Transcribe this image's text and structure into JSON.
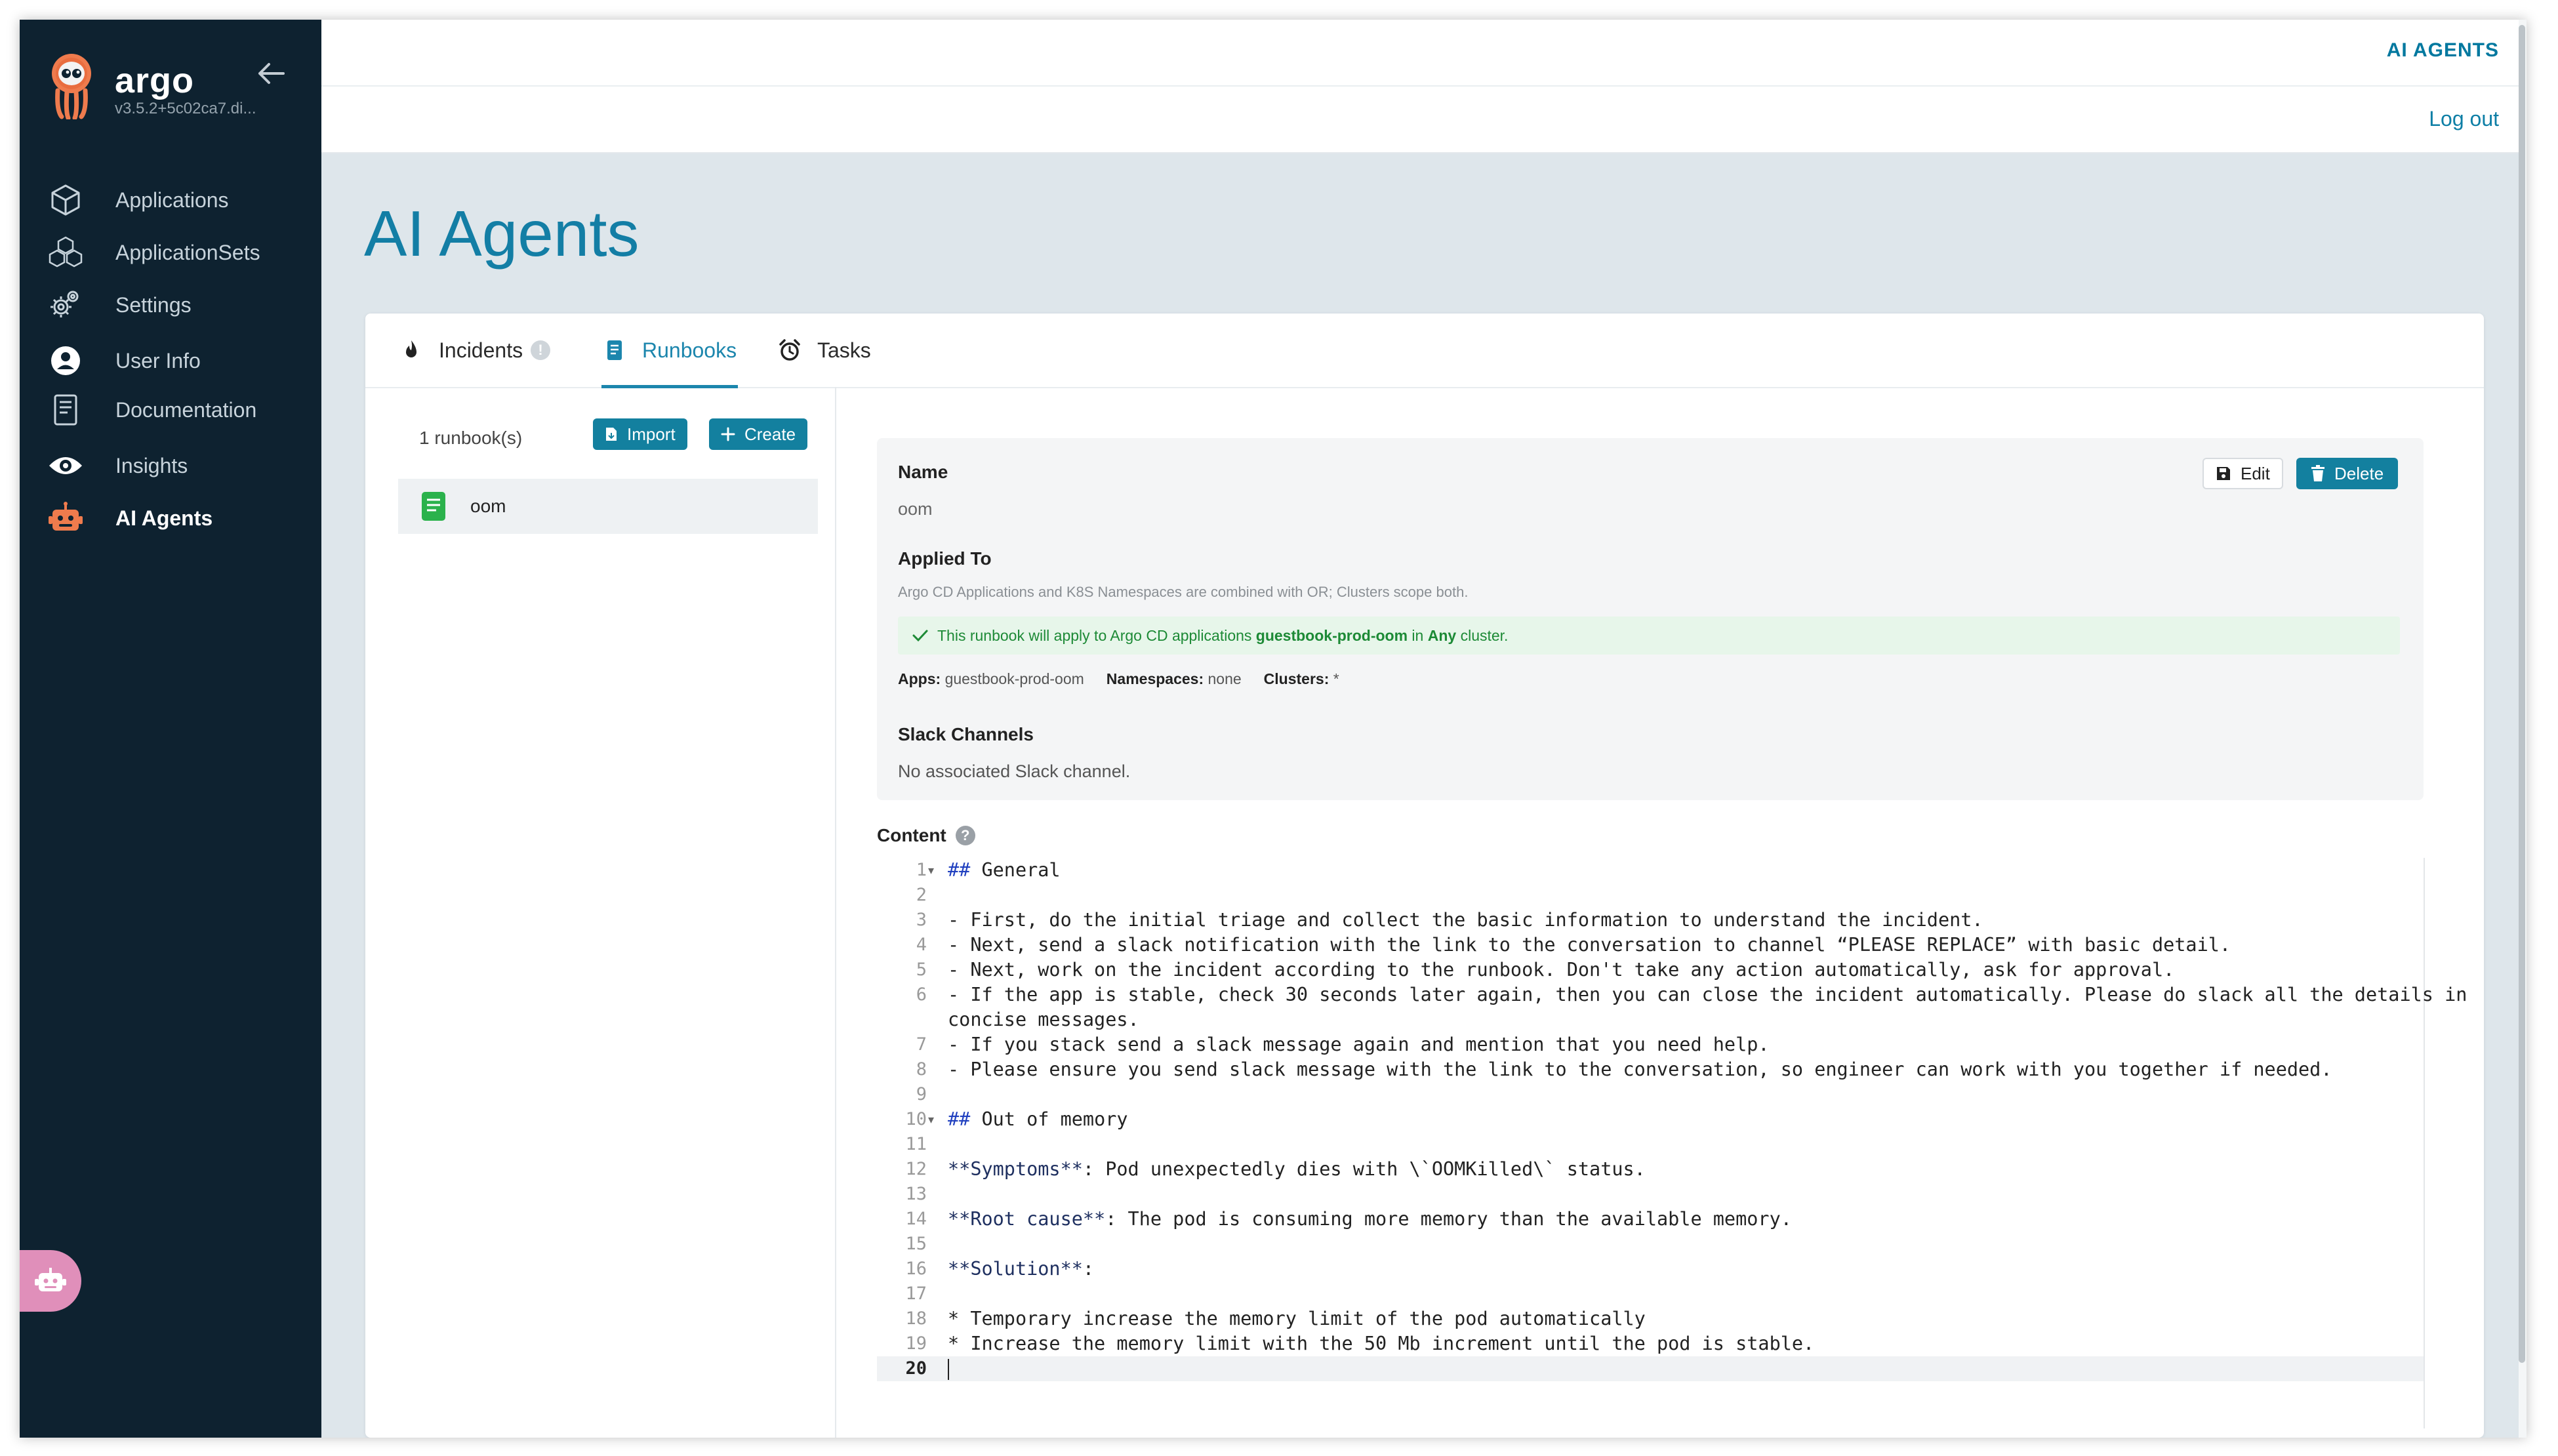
{
  "sidebar": {
    "brand": "argo",
    "version": "v3.5.2+5c02ca7.di...",
    "items": [
      {
        "label": "Applications",
        "icon": "cube-icon"
      },
      {
        "label": "ApplicationSets",
        "icon": "cubes-icon"
      },
      {
        "label": "Settings",
        "icon": "gears-icon"
      },
      {
        "label": "User Info",
        "icon": "user-circle-icon"
      },
      {
        "label": "Documentation",
        "icon": "book-icon"
      },
      {
        "label": "Insights",
        "icon": "eye-icon"
      },
      {
        "label": "AI Agents",
        "icon": "robot-icon",
        "active": true
      }
    ]
  },
  "topbar": {
    "section_link": "AI AGENTS",
    "logout": "Log out"
  },
  "page": {
    "title": "AI Agents"
  },
  "tabs": [
    {
      "label": "Incidents",
      "icon": "flame-icon"
    },
    {
      "label": "Runbooks",
      "icon": "book-icon",
      "active": true
    },
    {
      "label": "Tasks",
      "icon": "alarm-clock-icon"
    }
  ],
  "runbook_list": {
    "count_text": "1 runbook(s)",
    "import_label": "Import",
    "create_label": "Create",
    "items": [
      {
        "label": "oom"
      }
    ]
  },
  "detail": {
    "name_title": "Name",
    "name_value": "oom",
    "edit_label": "Edit",
    "delete_label": "Delete",
    "applied_title": "Applied To",
    "applied_hint": "Argo CD Applications and K8S Namespaces are combined with OR; Clusters scope both.",
    "success_prefix": "This runbook will apply to Argo CD applications ",
    "success_app": "guestbook-prod-oom",
    "success_mid": " in ",
    "success_cluster": "Any",
    "success_suffix": " cluster.",
    "apps_key": "Apps:",
    "apps_val": "guestbook-prod-oom",
    "ns_key": "Namespaces:",
    "ns_val": "none",
    "clusters_key": "Clusters:",
    "clusters_val": "*",
    "slack_title": "Slack Channels",
    "slack_value": "No associated Slack channel.",
    "content_title": "Content"
  },
  "editor": {
    "current_line": 20,
    "lines": [
      "## General",
      "",
      "- First, do the initial triage and collect the basic information to understand the incident.",
      "- Next, send a slack notification with the link to the conversation to channel “PLEASE REPLACE” with basic detail.",
      "- Next, work on the incident according to the runbook. Don't take any action automatically, ask for approval.",
      "- If the app is stable, check 30 seconds later again, then you can close the incident automatically. Please do slack all the details in concise messages.",
      "- If you stack send a slack message again and mention that you need help.",
      "- Please ensure you send slack message with the link to the conversation, so engineer can work with you together if needed.",
      "",
      "## Out of memory",
      "",
      "**Symptoms**: Pod unexpectedly dies with \\`OOMKilled\\` status.",
      "",
      "**Root cause**: The pod is consuming more memory than the available memory.",
      "",
      "**Solution**:",
      "",
      "* Temporary increase the memory limit of the pod automatically",
      "* Increase the memory limit with the 50 Mb increment until the pod is stable.",
      ""
    ]
  },
  "colors": {
    "accent": "#13809f",
    "sidebar_bg": "#0e2230",
    "title": "#137ea5",
    "success_text": "#1d8a36",
    "success_bg": "#e7f6ea"
  }
}
